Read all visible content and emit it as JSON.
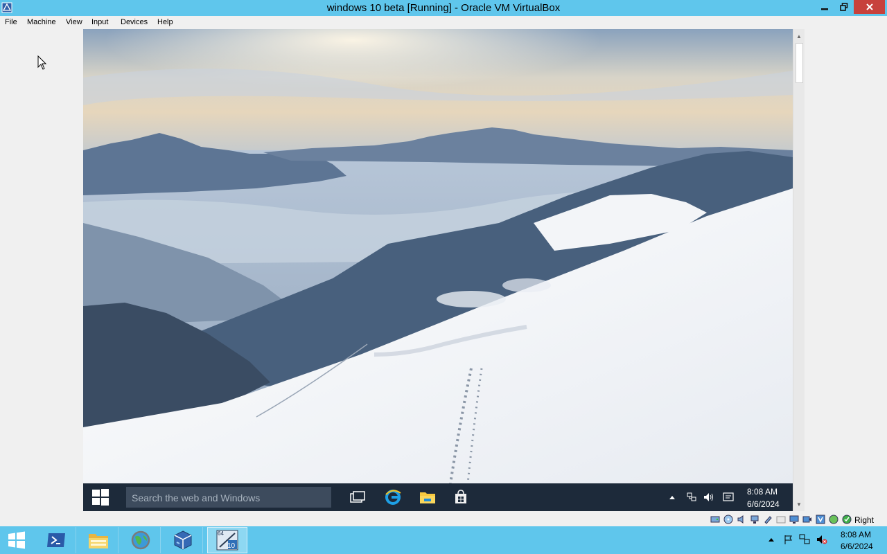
{
  "window": {
    "title": "windows 10 beta [Running] - Oracle VM VirtualBox",
    "colors": {
      "titlebar": "#5fc6ec",
      "close": "#c7413c"
    }
  },
  "menu": {
    "items": [
      "File",
      "Machine",
      "View",
      "Input",
      "Devices",
      "Help"
    ]
  },
  "guest": {
    "search_placeholder": "Search the web and Windows",
    "clock_time": "8:08 AM",
    "clock_date": "6/6/2024",
    "taskbar_icons": [
      "task-view-icon",
      "edge-icon",
      "file-explorer-icon",
      "store-icon"
    ],
    "tray_icons": [
      "show-hidden-icons-icon",
      "network-icon",
      "volume-icon",
      "action-center-icon"
    ]
  },
  "statusbar": {
    "host_key": "Right Ctrl",
    "icons": [
      "hard-disk-icon",
      "optical-drive-icon",
      "audio-icon",
      "network-adapter-icon",
      "usb-icon",
      "shared-folders-icon",
      "display-icon",
      "video-capture-icon",
      "recording-icon",
      "cpu-icon",
      "mouse-integration-icon",
      "keyboard-icon"
    ]
  },
  "host": {
    "clock_time": "8:08 AM",
    "clock_date": "6/6/2024",
    "taskbar_items": [
      "start-icon",
      "powershell-icon",
      "file-explorer-icon",
      "network-globe-icon",
      "virtualbox-manager-icon",
      "windows-10-vm-icon"
    ],
    "vm_badge_top": "64",
    "vm_badge_bottom": "10"
  }
}
